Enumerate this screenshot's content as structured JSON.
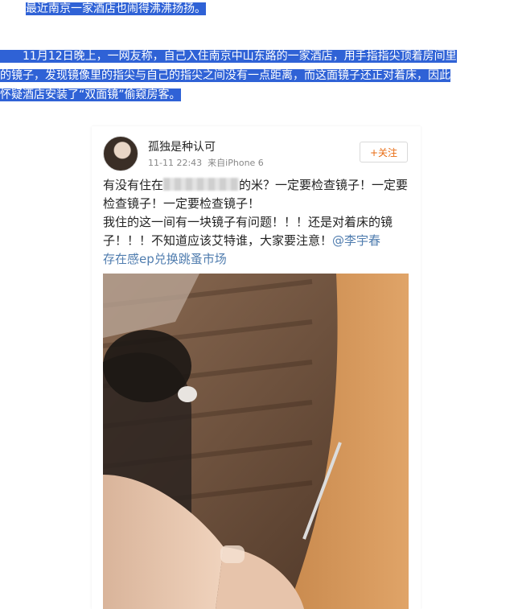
{
  "intro": {
    "headline": "最近南京一家酒店也闹得沸沸扬扬。",
    "paragraph_lines": [
      "　　11月12日晚上，一网友称，自己入住南京中山东路的一家酒店，用手指指尖顶着房间里",
      "的镜子，发现镜像里的指尖与自己的指尖之间没有一点距离，而这面镜子还正对着床，因此",
      "怀疑酒店安装了“双面镜”偷窥房客。"
    ]
  },
  "post": {
    "username": "孤独是种认可",
    "timestamp": "11-11 22:43",
    "device": "来自iPhone 6",
    "follow_label": "+关注",
    "text_before_blur": "有没有住在",
    "text_after_blur": "的米？一定要检查镜子！一定要检查镜子！一定要检查镜子！",
    "text_line2": "我住的这一间有一块镜子有问题！！！还是对着床的镜子！！！不知道应该艾特谁，大家要注意！",
    "mention": "@李宇春",
    "link_text": "存在感ep兑换跳蚤市场"
  },
  "colors": {
    "selection": "#2f62d6",
    "follow_text": "#e86b12",
    "link": "#507daf"
  }
}
